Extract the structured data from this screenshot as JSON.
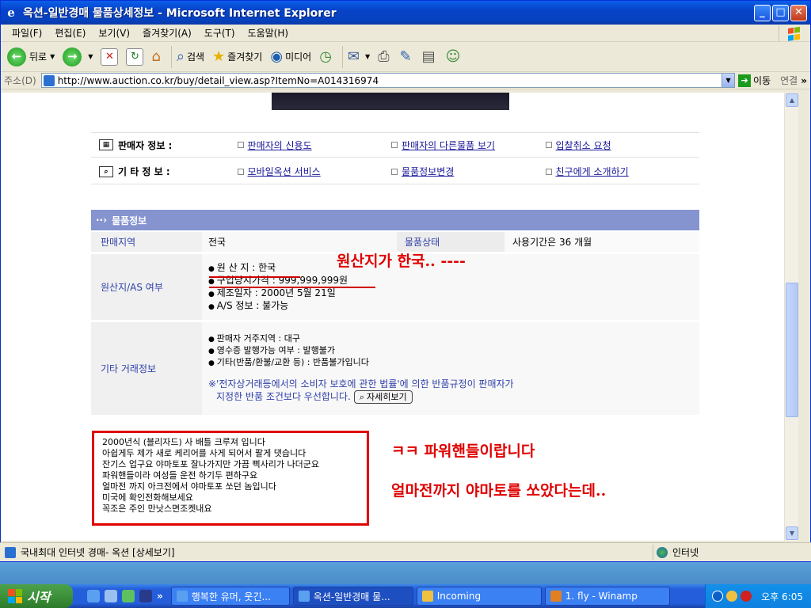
{
  "window": {
    "title": "옥션-일반경매 물품상세정보 - Microsoft Internet Explorer"
  },
  "menu": [
    "파일(F)",
    "편집(E)",
    "보기(V)",
    "즐겨찾기(A)",
    "도구(T)",
    "도움말(H)"
  ],
  "toolbar": {
    "back": "뒤로",
    "search": "검색",
    "favorites": "즐겨찾기",
    "media": "미디어"
  },
  "address": {
    "label": "주소(D)",
    "url": "http://www.auction.co.kr/buy/detail_view.asp?ItemNo=A014316974",
    "go": "이동",
    "links": "연결"
  },
  "info": {
    "seller_head": "판매자 정보 :",
    "other_head": "기 타 정 보 :",
    "seller_links": [
      "판매자의 신용도",
      "판매자의 다른물품 보기",
      "입찰취소 요청"
    ],
    "other_links": [
      "모바일옥션 서비스",
      "물품정보변경",
      "친구에게 소개하기"
    ]
  },
  "item_info": {
    "header": "물품정보",
    "region_label": "판매지역",
    "region_value": "전국",
    "condition_label": "물품상태",
    "condition_value": "사용기간은 36 개월",
    "origin_label": "원산지/AS 여부",
    "origin_bullets": [
      "원 산 지 : 한국",
      "구입당시가격 : 999,999,999원",
      "제조일자 : 2000년 5월 21일",
      "A/S 정보 : 불가능"
    ],
    "trade_label": "기타 거래정보",
    "trade_bullets": [
      "판매자 거주지역 : 대구",
      "영수증 발행가능 여부 : 발행불가",
      "기타(반품/환불/교환 등) : 반품불가입니다"
    ],
    "notice_line1": "※'전자상거래등에서의 소비자 보호에 관한 법률'에 의한 반품규정이 판매자가",
    "notice_line2": "지정한 반품 조건보다 우선합니다.",
    "detail_button": "자세히보기"
  },
  "description": [
    "2000년식 (블리자드) 사 배틀 크루져 입니다",
    "아쉽게두 제가 새로 케리어를 사게 되어서 팔게 댓습니다",
    "잔기스 업구요 야마토포 잘나가지만 가끔 삑사리가 나더군요",
    "파워핸들이라 여성들 운전 하기두 편하구요",
    "얼마전 까지 아크전에서 야마토포 쏘던 놈입니다",
    "미국에 확인전화해보세요",
    "꼭조은 주인 만낫스면조켓내요"
  ],
  "annotations": {
    "origin": "원산지가 한국.. ----",
    "power": "ㅋㅋ 파워핸들이랍니다",
    "yamato": "얼마전까지 야마토를 쏘았다는데.."
  },
  "status": {
    "text": "국내최대 인터넷 경매- 옥션 [상세보기]",
    "zone": "인터넷"
  },
  "taskbar": {
    "start": "시작",
    "tasks": [
      "행복한 유머, 웃긴...",
      "옥션-일반경매 물...",
      "Incoming",
      "1. fly - Winamp"
    ],
    "clock": "오후 6:05"
  }
}
